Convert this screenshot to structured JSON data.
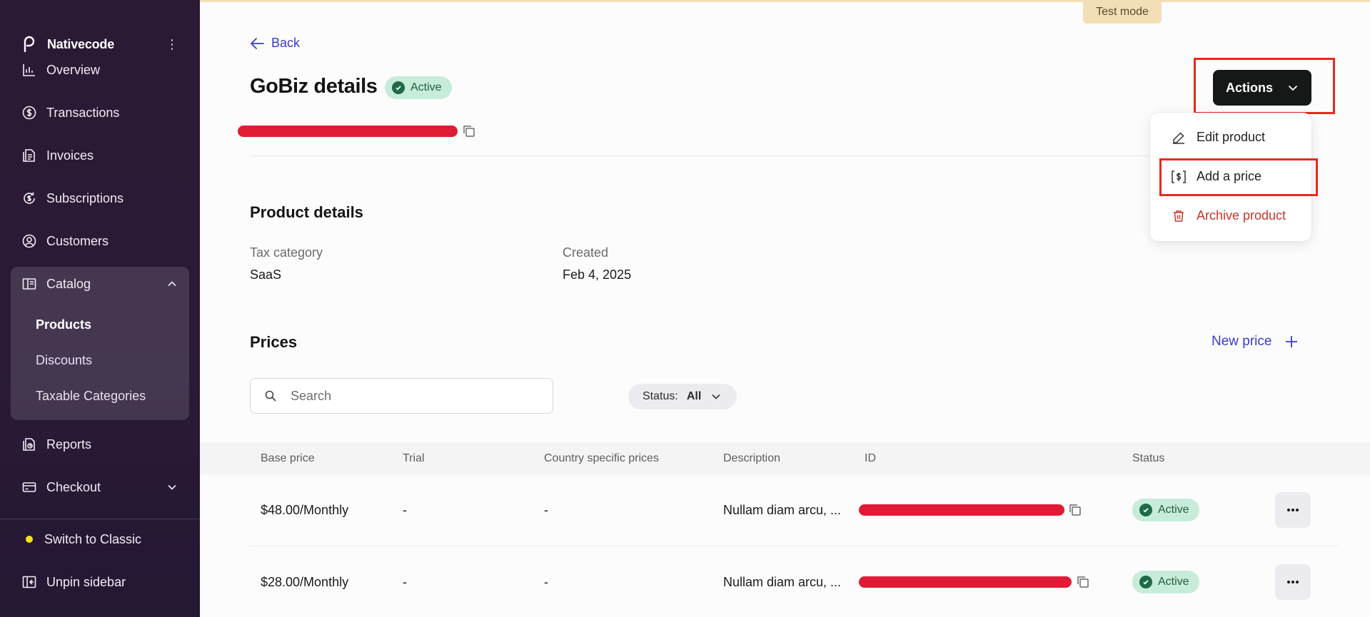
{
  "sidebar": {
    "brand": "Nativecode",
    "nav": {
      "overview": "Overview",
      "transactions": "Transactions",
      "invoices": "Invoices",
      "subscriptions": "Subscriptions",
      "customers": "Customers",
      "catalog": "Catalog",
      "reports": "Reports",
      "checkout": "Checkout"
    },
    "catalog_items": [
      "Products",
      "Discounts",
      "Taxable Categories"
    ],
    "footer": {
      "switch": "Switch to Classic",
      "unpin": "Unpin sidebar"
    }
  },
  "header": {
    "test_mode": "Test mode",
    "back": "Back",
    "title": "GoBiz details",
    "status": "Active",
    "actions": "Actions"
  },
  "actions_menu": {
    "edit": "Edit product",
    "add_price": "Add a price",
    "archive": "Archive product"
  },
  "product_details": {
    "heading": "Product details",
    "tax_category_label": "Tax category",
    "tax_category_value": "SaaS",
    "created_label": "Created",
    "created_value": "Feb 4, 2025"
  },
  "prices": {
    "heading": "Prices",
    "new_price": "New price",
    "search_placeholder": "Search",
    "filter_label": "Status:",
    "filter_value": "All",
    "columns": [
      "Base price",
      "Trial",
      "Country specific prices",
      "Description",
      "ID",
      "Status"
    ],
    "rows": [
      {
        "base_price": "$48.00/Monthly",
        "trial": "-",
        "country": "-",
        "description": "Nullam diam arcu, ...",
        "status": "Active"
      },
      {
        "base_price": "$28.00/Monthly",
        "trial": "-",
        "country": "-",
        "description": "Nullam diam arcu, ...",
        "status": "Active"
      }
    ]
  },
  "colors": {
    "accent": "#3b3dc6",
    "sidebar_bg": "#2b1a33",
    "active_pill": "#c7ecd9",
    "danger": "#c7382b",
    "highlight": "#e8291f",
    "redaction": "#e01b36"
  }
}
